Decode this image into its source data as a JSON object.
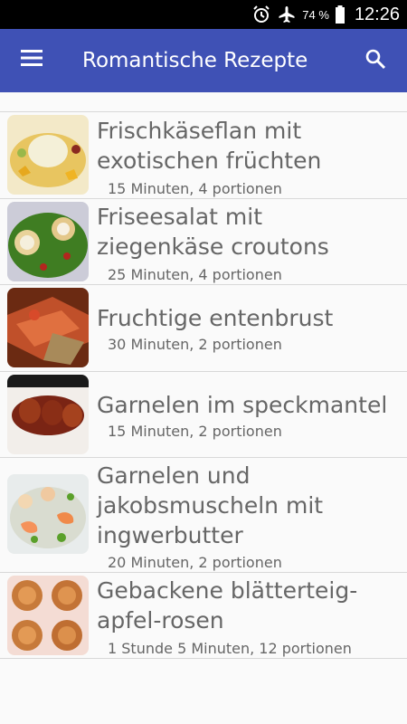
{
  "status": {
    "battery_pct": "74 %",
    "time": "12:26",
    "icons": [
      "alarm-icon",
      "airplane-mode-icon",
      "battery-icon"
    ]
  },
  "appbar": {
    "title": "Romantische Rezepte",
    "color": "#3f51b5",
    "menu_icon": "menu-icon",
    "search_icon": "search-icon"
  },
  "recipes": [
    {
      "name": "Frischkäseflan mit exotischen früchten",
      "meta": "15 Minuten, 4 portionen"
    },
    {
      "name": "Friseesalat mit ziegenkäse croutons",
      "meta": "25 Minuten, 4 portionen"
    },
    {
      "name": "Fruchtige entenbrust",
      "meta": "30 Minuten, 2 portionen"
    },
    {
      "name": "Garnelen im speckmantel",
      "meta": "15 Minuten, 2 portionen"
    },
    {
      "name": "Garnelen und jakobsmuscheln mit ingwerbutter",
      "meta": "20 Minuten, 2 portionen"
    },
    {
      "name": "Gebackene blätterteig-apfel-rosen",
      "meta": "1 Stunde 5 Minuten, 12 portionen"
    }
  ]
}
